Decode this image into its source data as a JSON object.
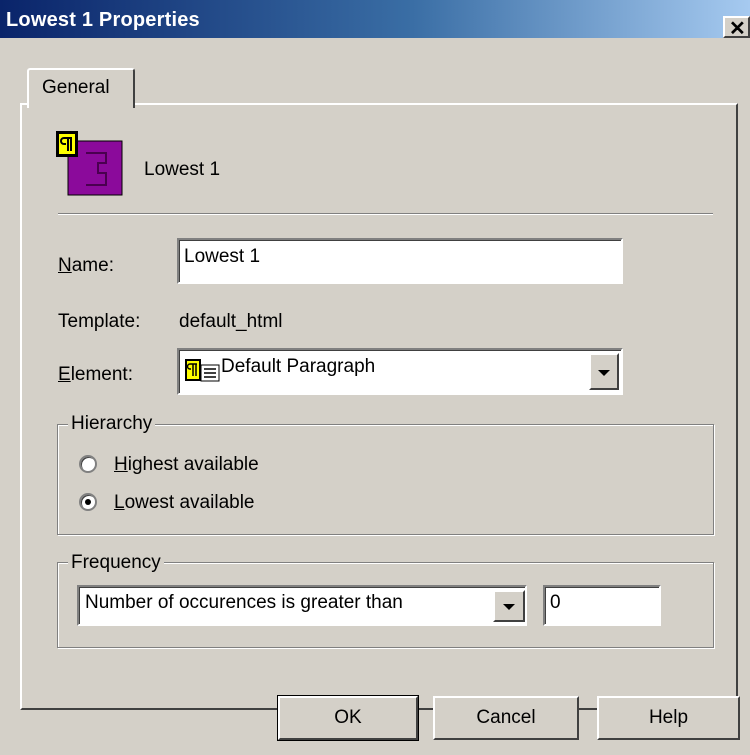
{
  "window": {
    "title": "Lowest 1 Properties",
    "close_glyph": "✕"
  },
  "tabs": [
    {
      "label": "General",
      "active": true
    }
  ],
  "header": {
    "icon": "paragraph-style-icon",
    "name": "Lowest 1"
  },
  "form": {
    "name_label_key": "N",
    "name_label_rest": "ame:",
    "name_value": "Lowest 1",
    "template_label": "Template:",
    "template_value": "default_html",
    "element_label_key": "E",
    "element_label_rest": "lement:",
    "element_icon": "paragraph-style-icon",
    "element_value": "Default Paragraph"
  },
  "hierarchy": {
    "legend": "Hierarchy",
    "options": [
      {
        "key": "H",
        "rest": "ighest available",
        "selected": false
      },
      {
        "key": "L",
        "rest": "owest available",
        "selected": true
      }
    ]
  },
  "frequency": {
    "legend": "Frequency",
    "condition": "Number of occurences is greater than",
    "value": "0"
  },
  "buttons": {
    "ok": "OK",
    "cancel": "Cancel",
    "help": "Help"
  },
  "colors": {
    "titlebar_start": "#0a246a",
    "titlebar_end": "#a6caf0",
    "icon_purple": "#8b0a9b",
    "icon_yellow": "#ffff00"
  }
}
